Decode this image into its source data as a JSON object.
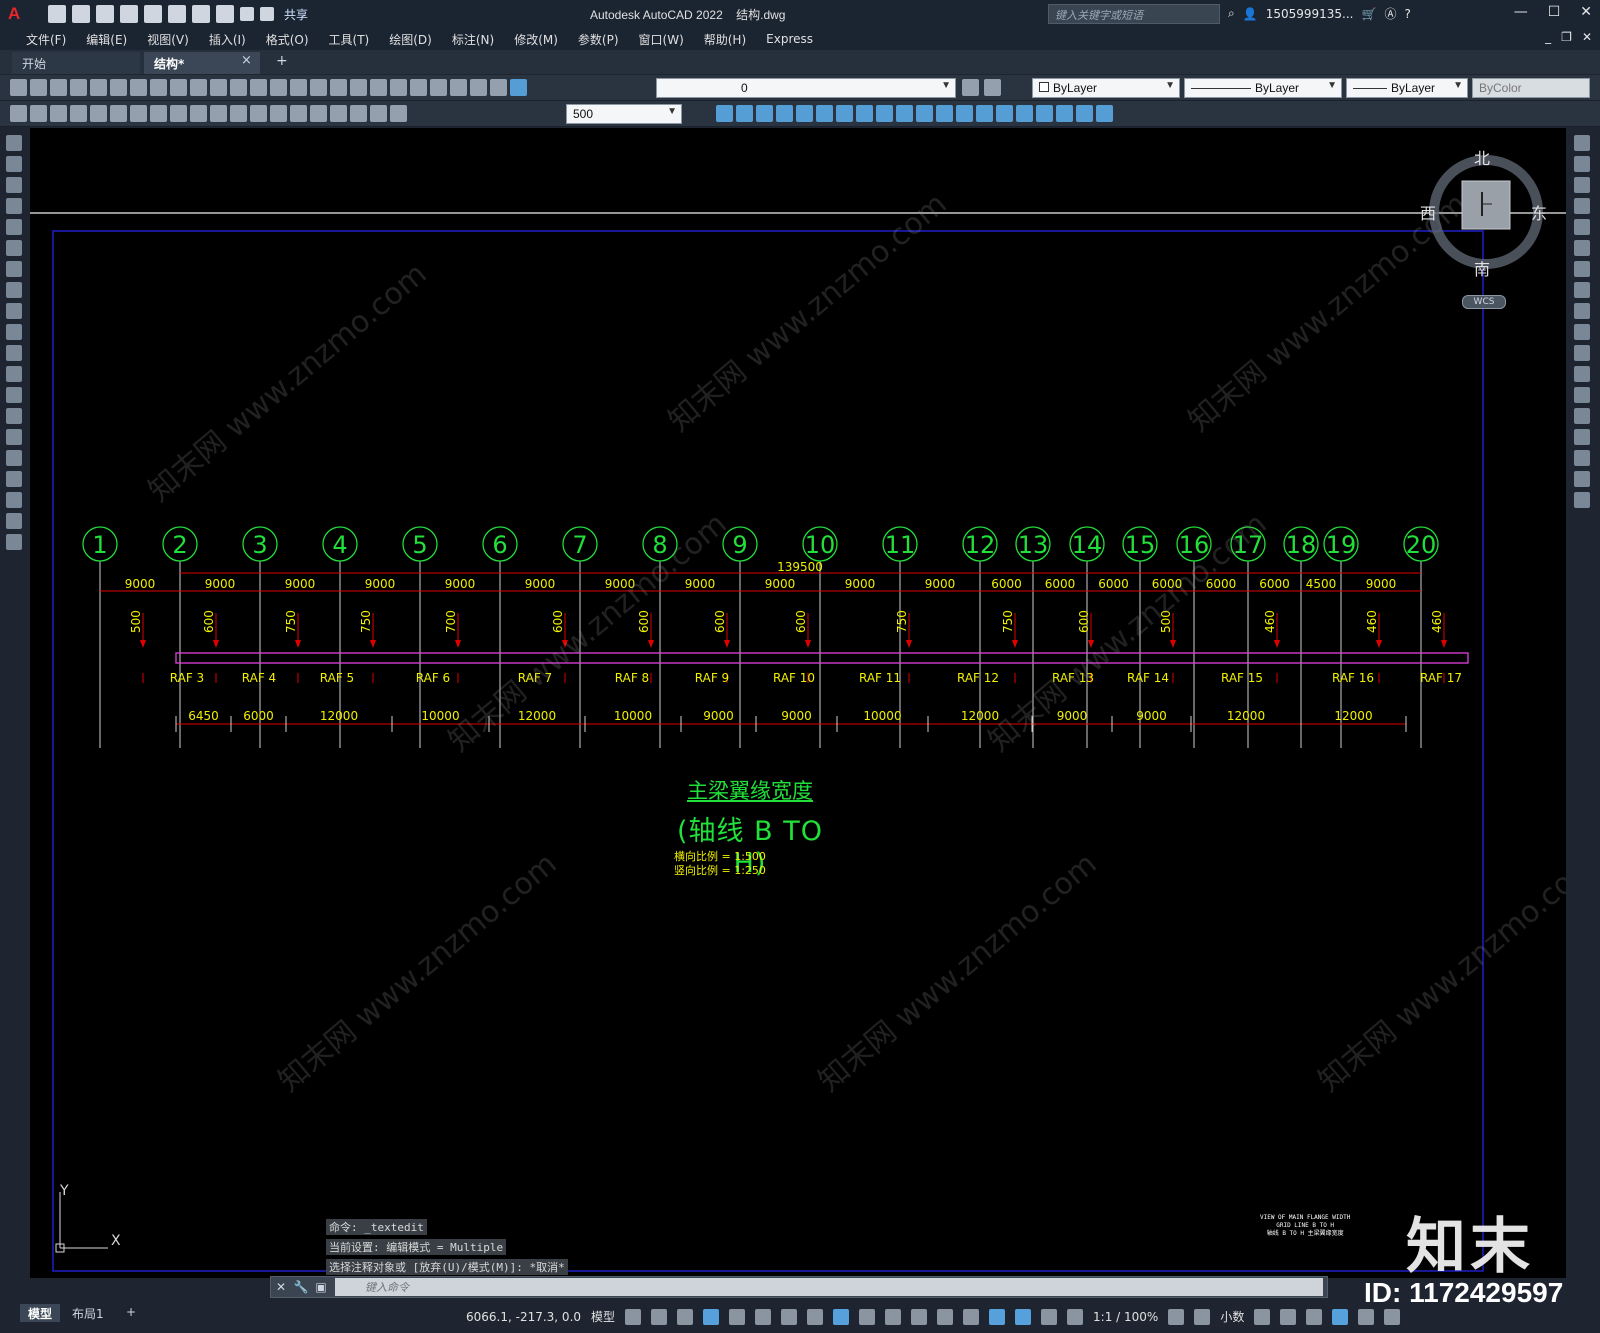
{
  "app": {
    "logo": "A",
    "title": "Autodesk AutoCAD 2022",
    "filename": "结构.dwg",
    "share": "共享",
    "search_placeholder": "键入关键字或短语",
    "user": "1505999135...",
    "window_controls": [
      "—",
      "☐",
      "✕"
    ]
  },
  "menu": [
    "文件(F)",
    "编辑(E)",
    "视图(V)",
    "插入(I)",
    "格式(O)",
    "工具(T)",
    "绘图(D)",
    "标注(N)",
    "修改(M)",
    "参数(P)",
    "窗口(W)",
    "帮助(H)",
    "Express"
  ],
  "tabs": {
    "start": "开始",
    "current": "结构*",
    "close": "×",
    "add": "+"
  },
  "toolbar": {
    "layer": "0",
    "color": "ByLayer",
    "linetype": "ByLayer",
    "lineweight": "ByLayer",
    "plotstyle": "ByColor",
    "dimscale": "500"
  },
  "viewcube": {
    "north": "北",
    "south": "南",
    "east": "东",
    "west": "西",
    "wcs": "WCS"
  },
  "drawing": {
    "total": "139500",
    "grid_labels": [
      "1",
      "2",
      "3",
      "4",
      "5",
      "6",
      "7",
      "8",
      "9",
      "10",
      "11",
      "12",
      "13",
      "14",
      "15",
      "16",
      "17",
      "18",
      "19",
      "20"
    ],
    "spans": [
      "9000",
      "9000",
      "9000",
      "9000",
      "9000",
      "9000",
      "9000",
      "9000",
      "9000",
      "9000",
      "9000",
      "6000",
      "6000",
      "6000",
      "6000",
      "6000",
      "6000",
      "4500",
      "9000"
    ],
    "flange_widths": [
      "500",
      "600",
      "750",
      "750",
      "700",
      "600",
      "600",
      "600",
      "600",
      "750",
      "750",
      "600",
      "500",
      "460",
      "460",
      "460"
    ],
    "raf_labels": [
      "RAF 3",
      "RAF 4",
      "RAF 5",
      "RAF 6",
      "RAF 7",
      "RAF 8",
      "RAF 9",
      "RAF 10",
      "RAF 11",
      "RAF 12",
      "RAF 13",
      "RAF 14",
      "RAF 15",
      "RAF 16",
      "RAF 17"
    ],
    "segment_lengths": [
      "6450",
      "6000",
      "12000",
      "10000",
      "12000",
      "10000",
      "9000",
      "9000",
      "10000",
      "12000",
      "9000",
      "9000",
      "12000",
      "12000"
    ],
    "title": "主梁翼缘宽度",
    "subtitle": "(轴线 B TO H)",
    "scale_h": "横向比例 = 1:500",
    "scale_v": "竖向比例 = 1:250",
    "corner_note_1": "VIEW OF MAIN FLANGE WIDTH",
    "corner_note_2": "GRID LINE B TO H",
    "corner_note_3": "轴线 B TO H 主梁翼缘宽度",
    "ucs_x": "X",
    "ucs_y": "Y"
  },
  "command": {
    "history": [
      "命令: _textedit",
      "当前设置: 编辑模式 = Multiple",
      "选择注释对象或 [放弃(U)/模式(M)]: *取消*"
    ],
    "placeholder": "键入命令"
  },
  "layout_tabs": {
    "model": "模型",
    "layout1": "布局1",
    "add": "+"
  },
  "status": {
    "coords": "6066.1, -217.3, 0.0",
    "model": "模型",
    "scale": "1:1 / 100%",
    "units": "小数"
  },
  "watermark": {
    "logo": "知末",
    "id": "ID: 1172429597",
    "text": "知末网 www.znzmo.com"
  }
}
